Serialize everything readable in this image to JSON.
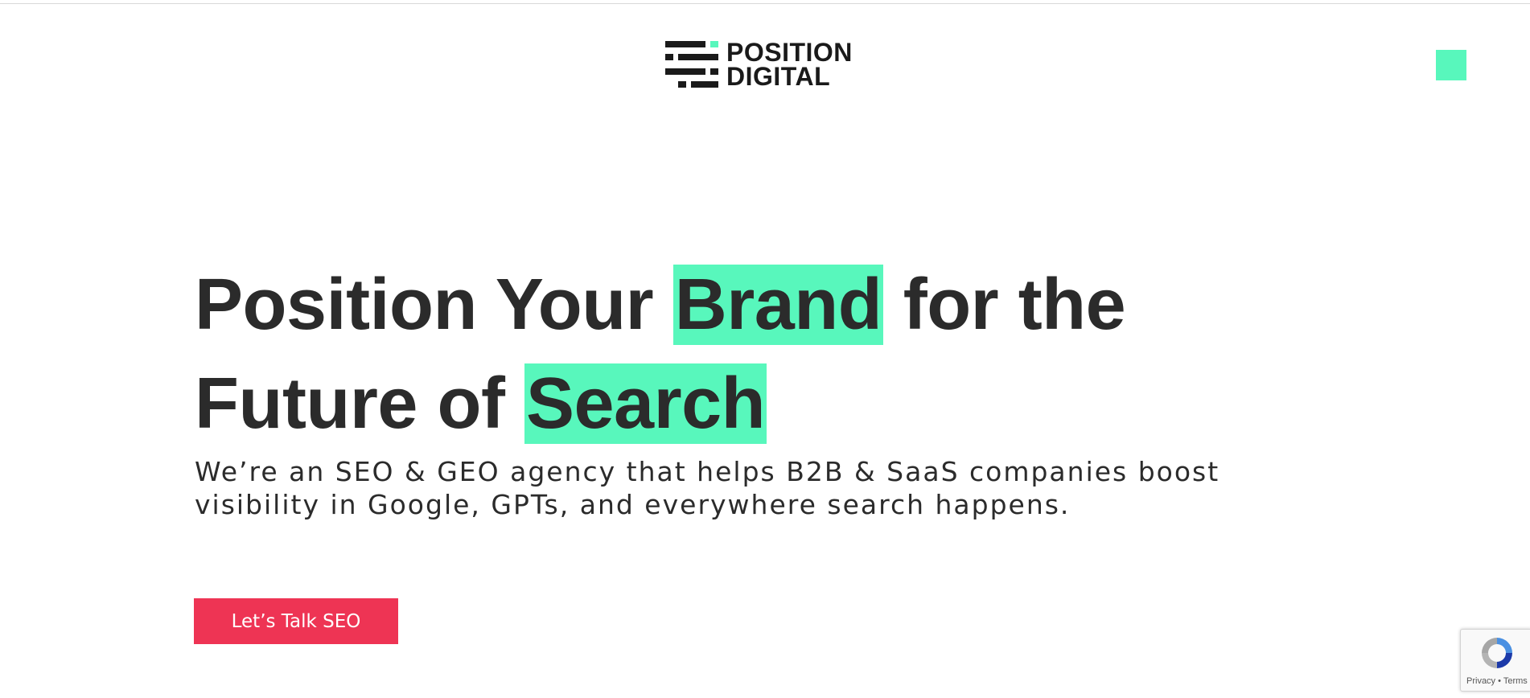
{
  "header": {
    "logo_line1": "POSITION",
    "logo_line2": "DIGITAL",
    "menu_icon": "menu-square-icon"
  },
  "hero": {
    "line1_pre": "Position Your ",
    "line1_highlight": "Brand",
    "line1_post": " for the",
    "line2_pre": "Future of ",
    "line2_highlight": "Search",
    "subtext": "We’re an SEO & GEO agency that helps B2B & SaaS companies boost visibility in Google, GPTs, and everywhere search happens.",
    "cta_label": "Let’s Talk SEO"
  },
  "recaptcha": {
    "privacy": "Privacy",
    "separator": " • ",
    "terms": "Terms"
  },
  "colors": {
    "accent": "#58f7bc",
    "cta": "#ee3454",
    "text": "#2b2b2b"
  }
}
